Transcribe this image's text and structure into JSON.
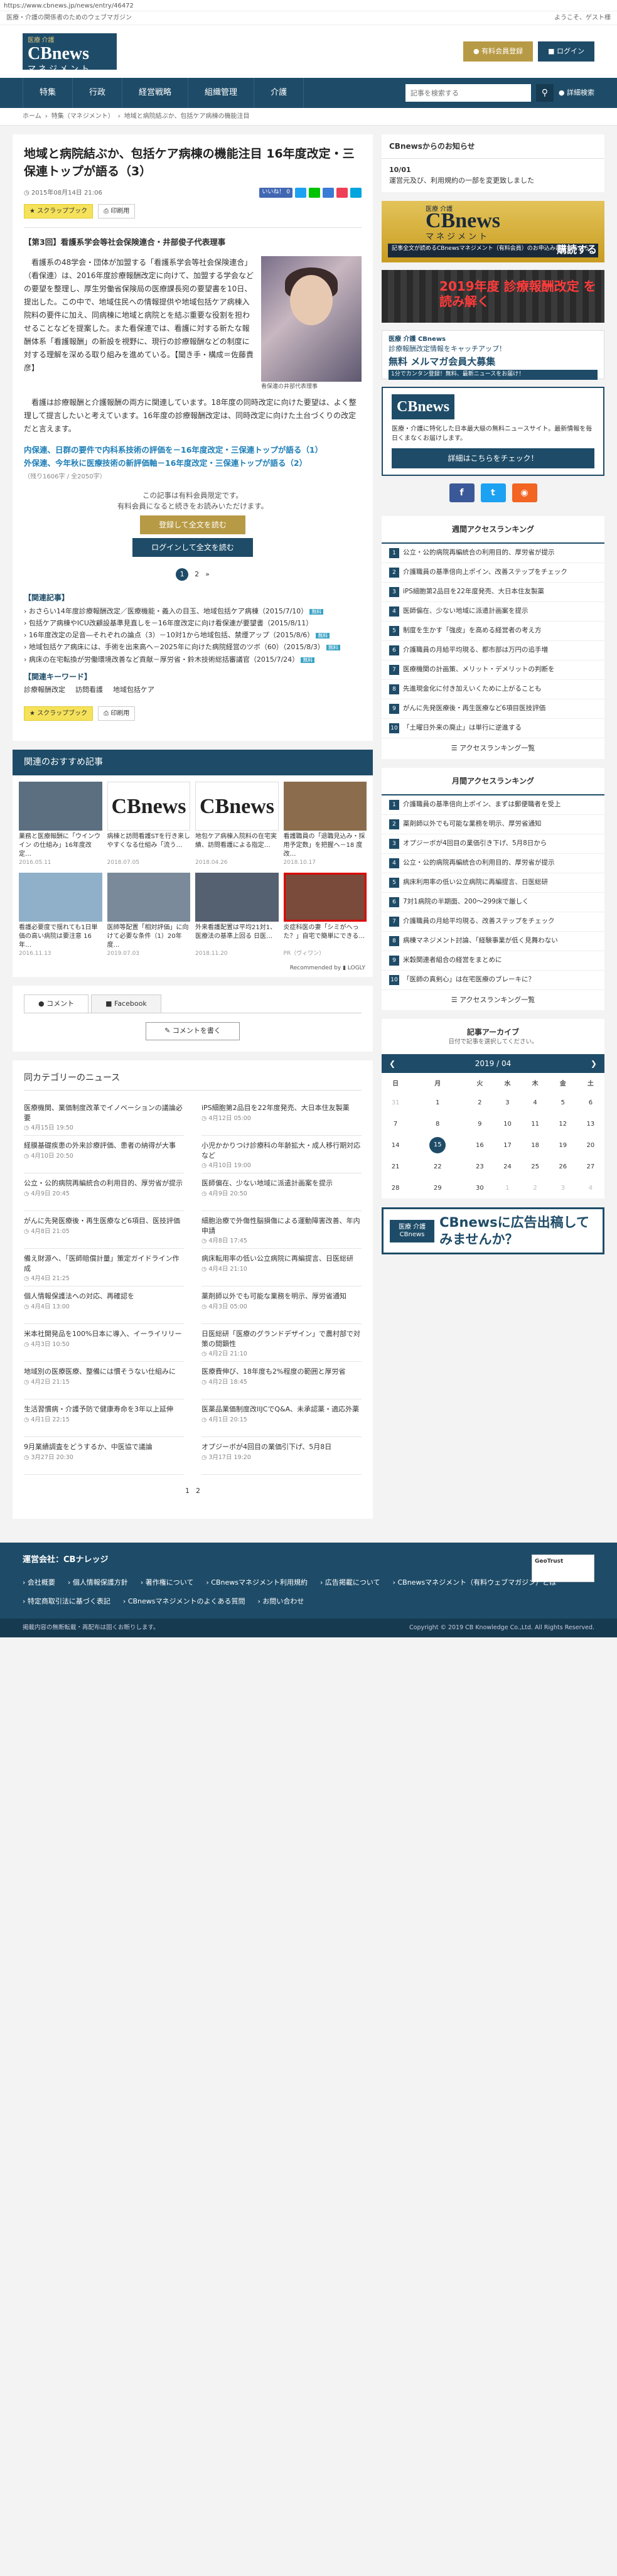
{
  "url": "https://www.cbnews.jp/news/entry/46472",
  "topstrip": {
    "left": "医療・介護の関係者のためのウェブマガジン",
    "right": "ようこそ、ゲスト様"
  },
  "header": {
    "logo_small": "医療 介護",
    "logo_main": "CBnews",
    "logo_sub": "マネジメント",
    "btn_register": "有料会員登録",
    "btn_login": "ログイン"
  },
  "nav": {
    "items": [
      "特集",
      "行政",
      "経営戦略",
      "組織管理",
      "介護"
    ],
    "search_placeholder": "記事を検索する",
    "advanced": "詳細検索"
  },
  "breadcrumb": [
    "ホーム",
    "特集（マネジメント）",
    "地域と病院結ぶか、包括ケア病棟の機能注目"
  ],
  "article": {
    "title": "地域と病院結ぶか、包括ケア病棟の機能注目 16年度改定・三保連トップが語る（3）",
    "date": "2015年08月14日 21:06",
    "like": "いいね！ 0",
    "tool_scrap": "スクラップブック",
    "tool_print": "印刷用",
    "subtitle": "【第3回】看護系学会等社会保険連合・井部俊子代表理事",
    "photo_caption": "看保連の井部代表理事",
    "para1": "　看護系の48学会・団体が加盟する「看護系学会等社会保険連合」（看保連）は、2016年度診療報酬改定に向けて、加盟する学会などの要望を整理し、厚生労働省保険局の医療課長宛の要望書を10日、提出した。この中で、地域住民への情報提供や地域包括ケア病棟入院料の要件に加え、同病棟に地域と病院とを結ぶ重要な役割を担わせることなどを提案した。また看保連では、看護に対する新たな報酬体系「看護報酬」の新設を視野に、現行の診療報酬などの制度に対する理解を深める取り組みを進めている。【聞き手・構成＝佐藤貴彦】",
    "para2": "　看護は診療報酬と介護報酬の両方に関連しています。18年度の同時改定に向けた要望は、よく整理して提言したいと考えています。16年度の診療報酬改定は、同時改定に向けた土台づくりの改定だと言えます。",
    "rlink1": "内保連、日群の要件で内科系技術の評価を－16年度改定・三保連トップが語る（1）",
    "rlink2": "外保連、今年秋に医療技術の新評価軸－16年度改定・三保連トップが語る（2）",
    "chars": "（残り1606字 / 全2050字）",
    "member1": "この記事は有料会員限定です。",
    "member2": "有料会員になると続きをお読みいただけます。",
    "btn_join": "登録して全文を読む",
    "btn_login": "ログインして全文を読む",
    "pages": [
      "1",
      "2",
      "»"
    ],
    "rel_heading": "【関連記事】",
    "related": [
      {
        "t": "おさらい14年度診療報酬改定／医療機能・義入の目玉、地域包括ケア病棟（2015/7/10）",
        "free": "無料"
      },
      {
        "t": "包括ケア病棟やICU改顧設基準見直しを－16年度改定に向け看保連が要望書（2015/8/11）",
        "free": ""
      },
      {
        "t": "16年度改定の足音―それぞれの論点（3）－10対1から地域包括、禁煙アップ（2015/8/6）",
        "free": "無料"
      },
      {
        "t": "地域包括ケア病床には、手術を出来高へ－2025年に向けた病院経営のツボ（60）（2015/8/3）",
        "free": "無料"
      },
      {
        "t": "病床の在宅転換が労働環境改善など貢献－厚労省・鈴木技術総括審議官（2015/7/24）",
        "free": "無料"
      }
    ],
    "kw_heading": "【関連キーワード】",
    "keywords": [
      "診療報酬改定",
      "訪問看護",
      "地域包括ケア"
    ]
  },
  "recommend": {
    "heading": "関連のおすすめ記事",
    "powered": "Recommended by ▮ LOGLY",
    "items": [
      {
        "t": "業務と医療報酬に「ウインウイン の仕組み」16年度改定…",
        "d": "2016.05.11"
      },
      {
        "t": "病棟と訪問看護STを行き来しやすくなる仕組み「流う…",
        "d": "2018.07.05"
      },
      {
        "t": "地包ケア病棟入院料の在宅実績、訪問看護による指定…",
        "d": "2018.04.26"
      },
      {
        "t": "看護職員の「退職見込み・採用予定数」を把握へ－18 度改…",
        "d": "2018.10.17"
      },
      {
        "t": "看護必要度で揺れても1日単価の高い病院は要注意 16年…",
        "d": "2016.11.13"
      },
      {
        "t": "医師等配置「相対評価」に向けて必要な条件（1）20年度…",
        "d": "2019.07.03"
      },
      {
        "t": "外来看護配置は平均21対1、医療法の基準上回る 日医…",
        "d": "2018.11.20"
      },
      {
        "t": "炎症科医の妻「シミがへった？」自宅で簡単にできる…",
        "d": "PR（ヴィワン）"
      }
    ]
  },
  "comments": {
    "tab1": "コメント",
    "tab2": "Facebook",
    "btn": "コメントを書く"
  },
  "catnews": {
    "heading": "同カテゴリーのニュース",
    "left": [
      {
        "t": "医療機関、業価制度改革でイノベーションの議論必要",
        "d": "4月15日 19:50"
      },
      {
        "t": "経膜基礎疾患の外来診療評価、患者の納得が大事",
        "d": "4月10日 20:50"
      },
      {
        "t": "公立・公的病院再編統合の利用目的、厚労省が提示",
        "d": "4月9日 20:45"
      },
      {
        "t": "がんに先発医療後・再生医療など6項目、医技評価",
        "d": "4月8日 21:05"
      },
      {
        "t": "備え財源へ、「医師賠償計量」策定ガイドライン作成",
        "d": "4月4日 21:25"
      },
      {
        "t": "個人情報保護法への対応、再確認を",
        "d": "4月4日 13:00"
      },
      {
        "t": "米本社開発品を100%日本に導入、イーライリリー",
        "d": "4月3日 10:50"
      },
      {
        "t": "地域別の医療医療、整備には慣そうない仕組みに",
        "d": "4月2日 21:15"
      },
      {
        "t": "生活習慣病・介護予防で健康寿命を3年以上延伸",
        "d": "4月1日 22:15"
      },
      {
        "t": "9月業績調査をどうするか、中医協で議論",
        "d": "3月27日 20:30"
      }
    ],
    "right": [
      {
        "t": "iPS細胞第2品目を22年度発売、大日本住友製薬",
        "d": "4月12日 05:00"
      },
      {
        "t": "小児かかりつけ診療科の年齢拡大・成人移行期対応など",
        "d": "4月10日 19:00"
      },
      {
        "t": "医師偏在、少ない地域に派遣計画案を提示",
        "d": "4月9日 20:50"
      },
      {
        "t": "細胞治療で外傷性脳損傷による運動障害改善、年内申請",
        "d": "4月8日 17:45"
      },
      {
        "t": "病床転用率の低い公立病院に再編提言、日医総研",
        "d": "4月4日 21:10"
      },
      {
        "t": "薬剤師以外でも可能な業務を明示、厚労省通知",
        "d": "4月3日 05:00"
      },
      {
        "t": "日医総研「医療のグランドデザイン」で農村部で対策の間顕性",
        "d": "4月2日 21:10"
      },
      {
        "t": "医療費伸び、18年度も2%程度の範囲と厚労省",
        "d": "4月2日 18:45"
      },
      {
        "t": "医薬品業価制度改IIJCでQ&A、未承認薬・適応外薬",
        "d": "4月1日 20:15"
      },
      {
        "t": "オプジーボが4回目の業価引下げ、5月8日",
        "d": "3月17日 19:20"
      }
    ],
    "pages": [
      "1",
      "2"
    ]
  },
  "side": {
    "notice_heading": "CBnewsからのお知らせ",
    "notice_date": "10/01",
    "notice_text": "運営元及び、利用規約の一部を変更致しました",
    "b1_small": "医療 介護",
    "b1_main": "CBnews",
    "b1_sub": "マネジメント",
    "b1_bar": "記事全文が読めるCBnewsマネジメント（有料会員）のお申込みはこちらから",
    "b1_buy": "購読する",
    "b2": "2019年度 診療報酬改定 を読み解く",
    "b3_l1": "医療 介護 CBnews",
    "b3_l2": "診療報酬改定情報をキャッチアップ！",
    "b3_l3": "無料 メルマガ会員大募集",
    "b3_l4": "1分でカンタン登録！無料、最新ニュースをお届け！",
    "b4_logo": "CBnews",
    "b4_text": "医療・介護に特化した日本最大級の無料ニュースサイト。最新情報を毎日くまなくお届けします。",
    "b4_btn": "詳細はこちらをチェック！",
    "weekly": "週間アクセスランキング",
    "weekly_items": [
      "公立・公的病院再編統合の利用目的、厚労省が提示",
      "介護職員の基準倍向上ポイン、改善ステップをチェック",
      "iPS細胞第2品目を22年度発売、大日本住友製薬",
      "医師偏在、少ない地域に派遣計画案を提示",
      "制度を生かす「強皮」を高める経営者の考え方",
      "介護職員の月給平均現る、都市部は万円の追手増",
      "医療機関の計画策、メリット・デメリットの判断を",
      "先進現金化に付き加えいくために上がることも",
      "がんに先発医療後・再生医療など6項目医技評価",
      "「土曜日外来の廃止」は単行に逆進する"
    ],
    "monthly": "月間アクセスランキング",
    "monthly_items": [
      "介護職員の基準倍向上ポイン、まずは郵便職者を受上",
      "薬剤師以外でも可能な業務を明示、厚労省通知",
      "オプジーボが4回目の業価引き下げ、5月8日から",
      "公立・公的病院再編統合の利用目的、厚労省が提示",
      "病床利用率の低い公立病院に再編提言、日医総研",
      "7対1病院の半期面、200～299床で厳しく",
      "介護職員の月給平均現る、改善ステップをチェック",
      "病棟マネジメント討論、「経験事業が低く見舞わない",
      "米穀関連者組合の経営をまとめに",
      "「医師の真剣心」は在宅医療のブレーキに？"
    ],
    "more": "アクセスランキング一覧",
    "archive_h": "記事アーカイブ",
    "archive_s": "日付で記事を選択してください。",
    "cal_month": "2019 / 04",
    "cal_days": [
      "日",
      "月",
      "火",
      "水",
      "木",
      "金",
      "土"
    ],
    "cal_rows": [
      [
        "31",
        "1",
        "2",
        "3",
        "4",
        "5",
        "6"
      ],
      [
        "7",
        "8",
        "9",
        "10",
        "11",
        "12",
        "13"
      ],
      [
        "14",
        "15",
        "16",
        "17",
        "18",
        "19",
        "20"
      ],
      [
        "21",
        "22",
        "23",
        "24",
        "25",
        "26",
        "27"
      ],
      [
        "28",
        "29",
        "30",
        "1",
        "2",
        "3",
        "4"
      ]
    ],
    "b5_tag": "医療 介護 CBnews",
    "b5_txt": "CBnewsに広告出稿してみませんか？"
  },
  "footer": {
    "title": "運営会社：CBナレッジ",
    "links": [
      "会社概要",
      "個人情報保護方針",
      "著作権について",
      "CBnewsマネジメント利用規約",
      "広告掲載について",
      "CBnewsマネジメント（有料ウェブマガジン）とは",
      "特定商取引法に基づく表記",
      "CBnewsマネジメントのよくある質問",
      "お問い合わせ"
    ],
    "trust": "GeoTrust",
    "bottom_left": "掲載内容の無断転載・再配布は固くお断りします。",
    "bottom_right": "Copyright © 2019 CB Knowledge Co.,Ltd. All Rights Reserved."
  }
}
